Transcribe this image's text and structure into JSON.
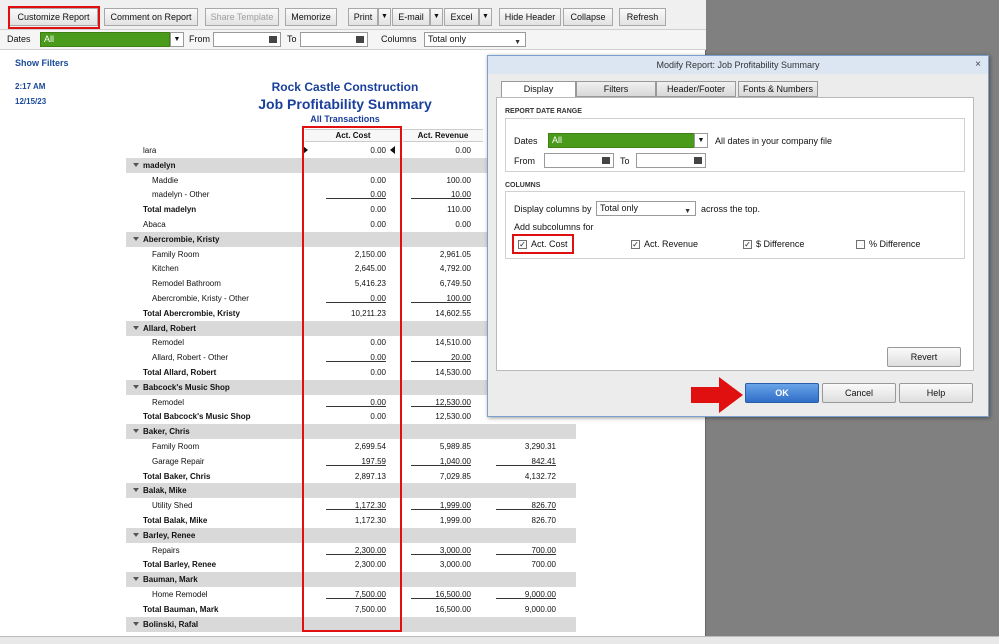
{
  "toolbar": {
    "customize": "Customize Report",
    "comment": "Comment on Report",
    "share": "Share Template",
    "memorize": "Memorize",
    "print": "Print",
    "email": "E-mail",
    "excel": "Excel",
    "hide_header": "Hide Header",
    "collapse": "Collapse",
    "refresh": "Refresh"
  },
  "filters": {
    "dates_label": "Dates",
    "dates_value": "All",
    "from_label": "From",
    "to_label": "To",
    "columns_label": "Columns",
    "columns_value": "Total only"
  },
  "show_filters": "Show Filters",
  "report": {
    "time": "2:17 AM",
    "date": "12/15/23",
    "company": "Rock Castle Construction",
    "title": "Job Profitability Summary",
    "subtitle": "All Transactions",
    "columns": [
      "Act. Cost",
      "Act. Revenue"
    ],
    "rows": [
      {
        "label": "lara",
        "type": "plain",
        "indent": 0,
        "cost": "0.00",
        "rev": "0.00",
        "diff": ""
      },
      {
        "label": "madelyn",
        "type": "group",
        "indent": 0,
        "cost": "",
        "rev": "",
        "diff": ""
      },
      {
        "label": "Maddie",
        "type": "plain",
        "indent": 1,
        "cost": "0.00",
        "rev": "100.00",
        "diff": ""
      },
      {
        "label": "madelyn - Other",
        "type": "plain",
        "indent": 1,
        "cost": "0.00",
        "rev": "10.00",
        "diff": "",
        "ul": true
      },
      {
        "label": "Total madelyn",
        "type": "total",
        "indent": 0,
        "cost": "0.00",
        "rev": "110.00",
        "diff": ""
      },
      {
        "label": "Abaca",
        "type": "plain",
        "indent": 0,
        "cost": "0.00",
        "rev": "0.00",
        "diff": ""
      },
      {
        "label": "Abercrombie, Kristy",
        "type": "group",
        "indent": 0,
        "cost": "",
        "rev": "",
        "diff": ""
      },
      {
        "label": "Family Room",
        "type": "plain",
        "indent": 1,
        "cost": "2,150.00",
        "rev": "2,961.05",
        "diff": ""
      },
      {
        "label": "Kitchen",
        "type": "plain",
        "indent": 1,
        "cost": "2,645.00",
        "rev": "4,792.00",
        "diff": ""
      },
      {
        "label": "Remodel Bathroom",
        "type": "plain",
        "indent": 1,
        "cost": "5,416.23",
        "rev": "6,749.50",
        "diff": ""
      },
      {
        "label": "Abercrombie, Kristy - Other",
        "type": "plain",
        "indent": 1,
        "cost": "0.00",
        "rev": "100.00",
        "diff": "",
        "ul": true
      },
      {
        "label": "Total Abercrombie, Kristy",
        "type": "total",
        "indent": 0,
        "cost": "10,211.23",
        "rev": "14,602.55",
        "diff": ""
      },
      {
        "label": "Allard, Robert",
        "type": "group",
        "indent": 0,
        "cost": "",
        "rev": "",
        "diff": ""
      },
      {
        "label": "Remodel",
        "type": "plain",
        "indent": 1,
        "cost": "0.00",
        "rev": "14,510.00",
        "diff": ""
      },
      {
        "label": "Allard, Robert - Other",
        "type": "plain",
        "indent": 1,
        "cost": "0.00",
        "rev": "20.00",
        "diff": "",
        "ul": true
      },
      {
        "label": "Total Allard, Robert",
        "type": "total",
        "indent": 0,
        "cost": "0.00",
        "rev": "14,530.00",
        "diff": ""
      },
      {
        "label": "Babcock's Music Shop",
        "type": "group",
        "indent": 0,
        "cost": "",
        "rev": "",
        "diff": ""
      },
      {
        "label": "Remodel",
        "type": "plain",
        "indent": 1,
        "cost": "0.00",
        "rev": "12,530.00",
        "diff": "",
        "ul": true
      },
      {
        "label": "Total Babcock's Music Shop",
        "type": "total",
        "indent": 0,
        "cost": "0.00",
        "rev": "12,530.00",
        "diff": ""
      },
      {
        "label": "Baker, Chris",
        "type": "group",
        "indent": 0,
        "cost": "",
        "rev": "",
        "diff": ""
      },
      {
        "label": "Family Room",
        "type": "plain",
        "indent": 1,
        "cost": "2,699.54",
        "rev": "5,989.85",
        "diff": "3,290.31"
      },
      {
        "label": "Garage Repair",
        "type": "plain",
        "indent": 1,
        "cost": "197.59",
        "rev": "1,040.00",
        "diff": "842.41",
        "ul": true
      },
      {
        "label": "Total Baker, Chris",
        "type": "total",
        "indent": 0,
        "cost": "2,897.13",
        "rev": "7,029.85",
        "diff": "4,132.72"
      },
      {
        "label": "Balak, Mike",
        "type": "group",
        "indent": 0,
        "cost": "",
        "rev": "",
        "diff": ""
      },
      {
        "label": "Utility Shed",
        "type": "plain",
        "indent": 1,
        "cost": "1,172.30",
        "rev": "1,999.00",
        "diff": "826.70",
        "ul": true
      },
      {
        "label": "Total Balak, Mike",
        "type": "total",
        "indent": 0,
        "cost": "1,172.30",
        "rev": "1,999.00",
        "diff": "826.70"
      },
      {
        "label": "Barley, Renee",
        "type": "group",
        "indent": 0,
        "cost": "",
        "rev": "",
        "diff": ""
      },
      {
        "label": "Repairs",
        "type": "plain",
        "indent": 1,
        "cost": "2,300.00",
        "rev": "3,000.00",
        "diff": "700.00",
        "ul": true
      },
      {
        "label": "Total Barley, Renee",
        "type": "total",
        "indent": 0,
        "cost": "2,300.00",
        "rev": "3,000.00",
        "diff": "700.00"
      },
      {
        "label": "Bauman, Mark",
        "type": "group",
        "indent": 0,
        "cost": "",
        "rev": "",
        "diff": ""
      },
      {
        "label": "Home Remodel",
        "type": "plain",
        "indent": 1,
        "cost": "7,500.00",
        "rev": "16,500.00",
        "diff": "9,000.00",
        "ul": true
      },
      {
        "label": "Total Bauman, Mark",
        "type": "total",
        "indent": 0,
        "cost": "7,500.00",
        "rev": "16,500.00",
        "diff": "9,000.00"
      },
      {
        "label": "Bolinski, Rafal",
        "type": "group",
        "indent": 0,
        "cost": "",
        "rev": "",
        "diff": ""
      }
    ]
  },
  "dialog": {
    "title": "Modify Report: Job Profitability Summary",
    "close": "×",
    "tabs": [
      "Display",
      "Filters",
      "Header/Footer",
      "Fonts & Numbers"
    ],
    "date_range_header": "REPORT DATE RANGE",
    "dates_label": "Dates",
    "dates_value": "All",
    "dates_note": "All dates in your company file",
    "from_label": "From",
    "to_label": "To",
    "columns_header": "COLUMNS",
    "display_by_label": "Display columns by",
    "display_by_value": "Total only",
    "across_label": "across the top.",
    "subcolumns_label": "Add subcolumns for",
    "checks": [
      {
        "label": "Act. Cost",
        "checked": "✓"
      },
      {
        "label": "Act. Revenue",
        "checked": "✓"
      },
      {
        "label": "$ Difference",
        "checked": "✓"
      },
      {
        "label": "% Difference",
        "checked": ""
      }
    ],
    "revert": "Revert",
    "ok": "OK",
    "cancel": "Cancel",
    "help": "Help"
  },
  "colors": {
    "accent_red": "#e01010",
    "green": "#4a9b1c",
    "ok_blue": "#2f6ec8"
  }
}
